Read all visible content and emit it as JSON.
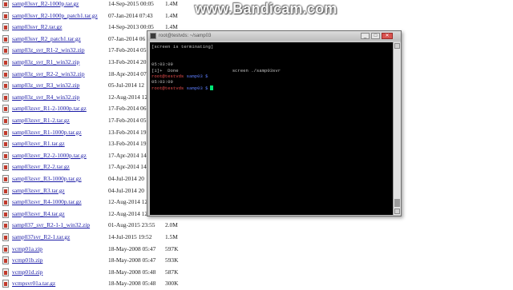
{
  "watermark": "www.Bandicam.com",
  "files": [
    {
      "name": "samp03svr_R2-1000p.tar.gz",
      "date": "14-Sep-2015 00:05",
      "size": "1.4M"
    },
    {
      "name": "samp03svr_R2-1000p_patch1.tar.gz",
      "date": "07-Jan-2014 07:43",
      "size": "1.4M"
    },
    {
      "name": "samp03svr_R2.tar.gz",
      "date": "14-Sep-2013 00:05",
      "size": "1.4M"
    },
    {
      "name": "samp03svr_R2_patch1.tar.gz",
      "date": "07-Jan-2014 06",
      "size": ""
    },
    {
      "name": "samp03z_svr_R1-2_win32.zip",
      "date": "17-Feb-2014 05",
      "size": ""
    },
    {
      "name": "samp03z_svr_R1_win32.zip",
      "date": "13-Feb-2014 20",
      "size": ""
    },
    {
      "name": "samp03z_svr_R2-2_win32.zip",
      "date": "18-Apr-2014 07",
      "size": ""
    },
    {
      "name": "samp03z_svr_R3_win32.zip",
      "date": "05-Jul-2014 12",
      "size": ""
    },
    {
      "name": "samp03z_svr_R4_win32.zip",
      "date": "12-Aug-2014 12",
      "size": ""
    },
    {
      "name": "samp03zsvr_R1-2-1000p.tar.gz",
      "date": "17-Feb-2014 06",
      "size": ""
    },
    {
      "name": "samp03zsvr_R1-2.tar.gz",
      "date": "17-Feb-2014 05",
      "size": ""
    },
    {
      "name": "samp03zsvr_R1-1000p.tar.gz",
      "date": "13-Feb-2014 19",
      "size": ""
    },
    {
      "name": "samp03zsvr_R1.tar.gz",
      "date": "13-Feb-2014 19",
      "size": ""
    },
    {
      "name": "samp03zsvr_R2-2-1000p.tar.gz",
      "date": "17-Apr-2014 14",
      "size": ""
    },
    {
      "name": "samp03zsvr_R2-2.tar.gz",
      "date": "17-Apr-2014 14",
      "size": ""
    },
    {
      "name": "samp03zsvr_R3-1000p.tar.gz",
      "date": "04-Jul-2014 20",
      "size": ""
    },
    {
      "name": "samp03zsvr_R3.tar.gz",
      "date": "04-Jul-2014 20",
      "size": ""
    },
    {
      "name": "samp03zsvr_R4-1000p.tar.gz",
      "date": "12-Aug-2014 12",
      "size": ""
    },
    {
      "name": "samp03zsvr_R4.tar.gz",
      "date": "12-Aug-2014 12",
      "size": ""
    },
    {
      "name": "samp037_svr_R2-1-1_win32.zip",
      "date": "01-Aug-2015 23:55",
      "size": "2.0M"
    },
    {
      "name": "samp037svr_R2-1.tar.gz",
      "date": "14-Jul-2015 19:52",
      "size": "1.5M"
    },
    {
      "name": "vcmp01a.zip",
      "date": "18-May-2008 05:47",
      "size": "597K"
    },
    {
      "name": "vcmp01b.zip",
      "date": "18-May-2008 05:47",
      "size": "593K"
    },
    {
      "name": "vcmp01d.zip",
      "date": "18-May-2008 05:48",
      "size": "587K"
    },
    {
      "name": "vcmpsvr01a.tar.gz",
      "date": "18-May-2008 05:48",
      "size": "300K"
    }
  ],
  "terminal": {
    "title": "root@testvds: ~/samp03",
    "minimize": "_",
    "maximize": "□",
    "close": "✕",
    "lines": [
      {
        "text": "[screen is terminating]"
      },
      {
        "text": ""
      },
      {
        "text": ""
      },
      {
        "text": "05:03:09"
      },
      {
        "text": "[1]+  Done                    screen ./samp03svr"
      },
      {
        "text": "root@testvds samp03 $",
        "prompt": true
      },
      {
        "text": "05:03:09"
      },
      {
        "text": "root@testvds samp03 $",
        "prompt": true,
        "cursor": true
      }
    ]
  },
  "icons": {
    "file": "file-icon",
    "terminal_app": "terminal-icon"
  }
}
